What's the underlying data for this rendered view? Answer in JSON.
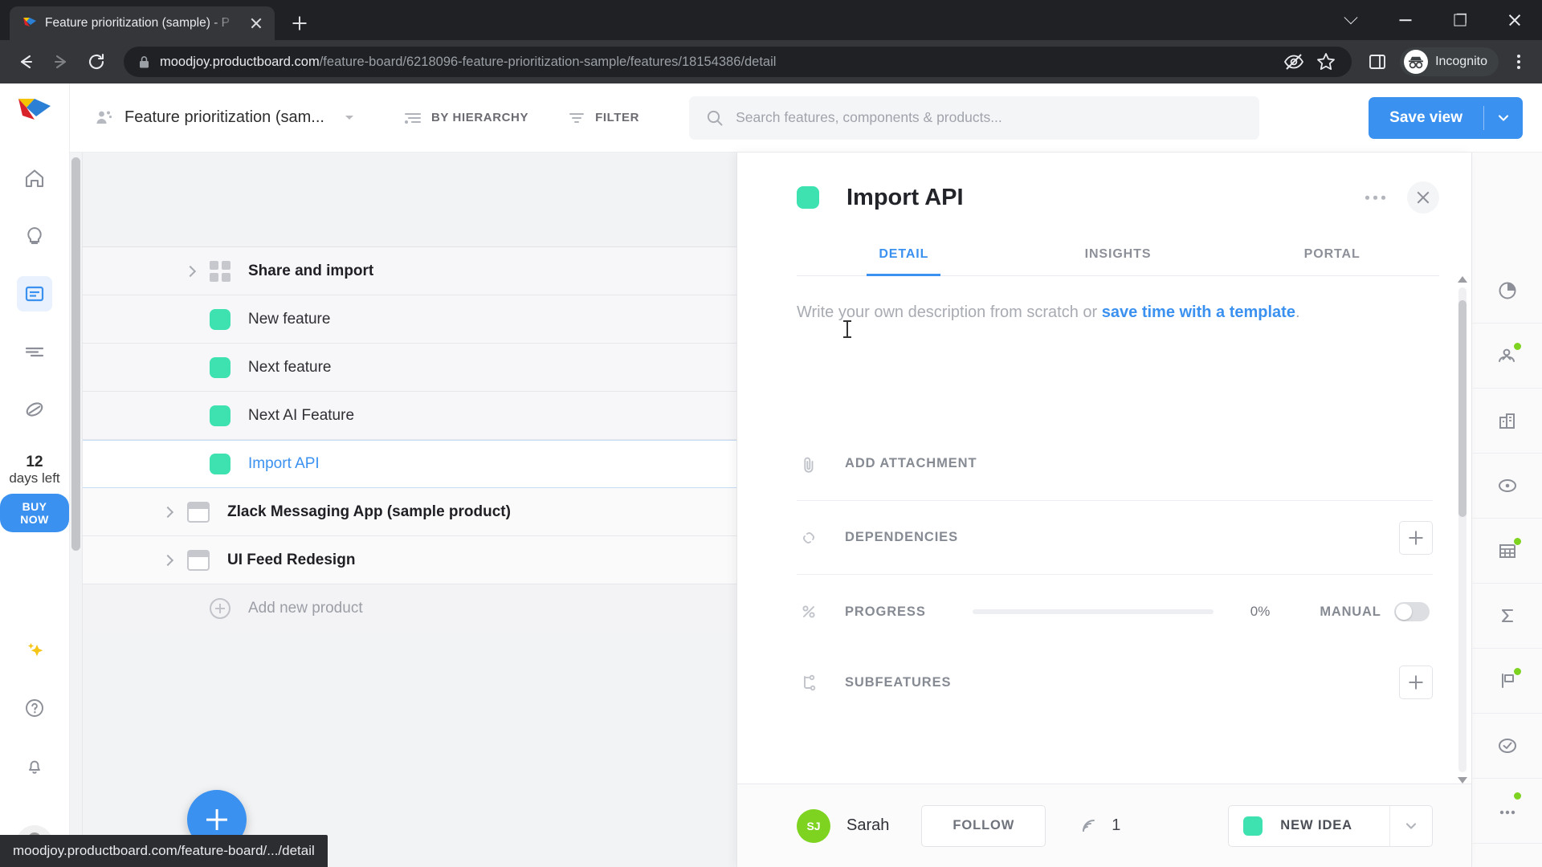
{
  "browser": {
    "tab": {
      "title": "Feature prioritization (sample) - P",
      "favicon": "productboard-logo-icon"
    },
    "newtab_label": "+",
    "window_controls": [
      "chevron-down",
      "minimize",
      "maximize",
      "close"
    ],
    "omnibox": {
      "lock_icon": "lock-icon",
      "url_domain": "moodjoy.productboard.com",
      "url_path": "/feature-board/6218096-feature-prioritization-sample/features/18154386/detail"
    },
    "actions": [
      "tracking-blocked-icon",
      "bookmark-star-icon",
      "side-panel-icon"
    ],
    "incognito_label": "Incognito",
    "menu": "kebab-menu-icon"
  },
  "statusbar": {
    "text": "moodjoy.productboard.com/feature-board/.../detail"
  },
  "left_rail": {
    "logo": "productboard-logo",
    "items": [
      {
        "name": "home",
        "icon": "home-icon",
        "active": false
      },
      {
        "name": "insights",
        "icon": "lightbulb-icon",
        "active": false
      },
      {
        "name": "features",
        "icon": "features-board-icon",
        "active": true
      },
      {
        "name": "roadmap",
        "icon": "roadmap-lines-icon",
        "active": false
      },
      {
        "name": "objectives",
        "icon": "objectives-icon",
        "active": false
      }
    ],
    "trial": {
      "days": "12",
      "label": "days left",
      "cta": "BUY NOW"
    },
    "bottom_items": [
      {
        "name": "ai-sparkle",
        "icon": "sparkle-icon"
      },
      {
        "name": "help",
        "icon": "question-circle-icon"
      },
      {
        "name": "notifications",
        "icon": "bell-icon"
      }
    ],
    "avatar": "user-avatar"
  },
  "app_header": {
    "board_icon": "board-users-icon",
    "board_name": "Feature prioritization (sam...",
    "hierarchy_label": "BY HIERARCHY",
    "filter_label": "FILTER",
    "search_placeholder": "Search features, components & products...",
    "save_view_label": "Save view"
  },
  "feature_list": {
    "rows": [
      {
        "type": "group",
        "label": "Share and import",
        "icon": "grid-icon",
        "expandable": true,
        "selected": false
      },
      {
        "type": "feature",
        "label": "New feature",
        "swatch": "#3de2b0",
        "expandable": false,
        "selected": false
      },
      {
        "type": "feature",
        "label": "Next feature",
        "swatch": "#3de2b0",
        "expandable": false,
        "selected": false
      },
      {
        "type": "feature",
        "label": "Next AI Feature",
        "swatch": "#3de2b0",
        "expandable": false,
        "selected": false
      },
      {
        "type": "feature",
        "label": "Import API",
        "swatch": "#3de2b0",
        "expandable": false,
        "selected": true
      },
      {
        "type": "product",
        "label": "Zlack Messaging App (sample product)",
        "icon": "product-icon",
        "expandable": true,
        "selected": false
      },
      {
        "type": "product",
        "label": "UI Feed Redesign",
        "icon": "product-icon",
        "expandable": true,
        "selected": false
      },
      {
        "type": "add",
        "label": "Add new product",
        "icon": "plus-circle-icon",
        "expandable": false,
        "selected": false
      }
    ],
    "fab": "add-feature-button"
  },
  "detail": {
    "swatch_color": "#3de2b0",
    "title": "Import API",
    "more_actions": "more-options-icon",
    "close": "close-icon",
    "tabs": [
      {
        "label": "DETAIL",
        "active": true
      },
      {
        "label": "INSIGHTS",
        "active": false
      },
      {
        "label": "PORTAL",
        "active": false
      }
    ],
    "description": {
      "prefix": "Write your own description from scratch or ",
      "link": "save time with a template",
      "suffix": "."
    },
    "rows": [
      {
        "name": "add-attachment",
        "icon": "paperclip-icon",
        "label": "ADD ATTACHMENT"
      },
      {
        "name": "dependencies",
        "icon": "dependency-icon",
        "label": "DEPENDENCIES",
        "action": "+"
      },
      {
        "name": "progress",
        "icon": "percent-icon",
        "label": "PROGRESS",
        "value": "0%",
        "mode": "MANUAL",
        "toggle_on": false,
        "progress_pct": 0
      },
      {
        "name": "subfeatures",
        "icon": "subfeatures-icon",
        "label": "SUBFEATURES",
        "action": "+"
      }
    ],
    "footer": {
      "avatar_initials": "SJ",
      "owner": "Sarah",
      "follow_label": "FOLLOW",
      "insights_icon": "insights-signal-icon",
      "insights_count": "1",
      "status_swatch": "#3de2b0",
      "status_label": "NEW IDEA"
    }
  },
  "right_rail": {
    "items": [
      {
        "name": "effort-score",
        "icon": "pie-chart-icon",
        "badge": false
      },
      {
        "name": "user-impact",
        "icon": "user-impact-icon",
        "badge": true
      },
      {
        "name": "company",
        "icon": "company-icon",
        "badge": false
      },
      {
        "name": "objective",
        "icon": "target-icon",
        "badge": false
      },
      {
        "name": "segments",
        "icon": "table-grid-icon",
        "badge": true
      },
      {
        "name": "score-sum",
        "icon": "sigma-icon",
        "badge": false
      },
      {
        "name": "release",
        "icon": "flag-icon",
        "badge": true
      },
      {
        "name": "status-check",
        "icon": "check-circle-icon",
        "badge": false
      },
      {
        "name": "more-columns",
        "icon": "more-dots-icon",
        "badge": true
      }
    ]
  },
  "colors": {
    "accent_blue": "#3b91f0",
    "teal": "#3de2b0",
    "green": "#7ed321",
    "chrome_dark": "#35363a"
  }
}
